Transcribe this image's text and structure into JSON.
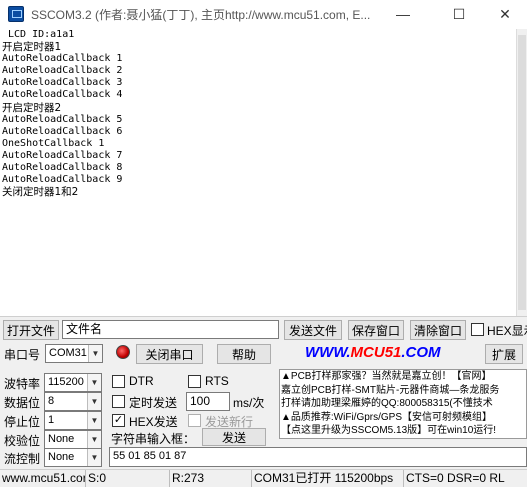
{
  "window": {
    "title": "SSCOM3.2 (作者:聂小猛(丁丁), 主页http://www.mcu51.com,  E...",
    "min_glyph": "—",
    "max_glyph": "☐",
    "close_glyph": "✕"
  },
  "receive_lines": [
    " LCD ID:a1a1",
    "开启定时器1",
    "AutoReloadCallback 1",
    "AutoReloadCallback 2",
    "AutoReloadCallback 3",
    "AutoReloadCallback 4",
    "开启定时器2",
    "AutoReloadCallback 5",
    "AutoReloadCallback 6",
    "OneShotCallback 1",
    "AutoReloadCallback 7",
    "AutoReloadCallback 8",
    "AutoReloadCallback 9",
    "关闭定时器1和2"
  ],
  "file_row": {
    "open_file_label": "打开文件",
    "filename_value": "文件名",
    "send_file_label": "发送文件",
    "save_window_label": "保存窗口",
    "clear_window_label": "清除窗口",
    "hex_display_label": "HEX显示"
  },
  "port_row": {
    "port_label": "串口号",
    "port_value": "COM31",
    "close_port_label": "关闭串口",
    "help_label": "帮助",
    "logo_blue_1": "WWW.",
    "logo_red": "MCU51",
    "logo_blue_2": ".COM",
    "expand_label": "扩展"
  },
  "settings": {
    "baud_label": "波特率",
    "baud_value": "115200",
    "databits_label": "数据位",
    "databits_value": "8",
    "stopbits_label": "停止位",
    "stopbits_value": "1",
    "parity_label": "校验位",
    "parity_value": "None",
    "flow_label": "流控制",
    "flow_value": "None"
  },
  "options": {
    "dtr_label": "DTR",
    "rts_label": "RTS",
    "timed_send_label": "定时发送",
    "interval_value": "100",
    "interval_unit": "ms/次",
    "hex_send_label": "HEX发送",
    "hex_send_checked": "✓",
    "send_newline_label": "发送新行",
    "input_label": "字符串输入框：",
    "send_label": "发送",
    "send_input_value": "55 01 85 01 87"
  },
  "ad_lines": [
    "▲PCB打样那家强？当然就是嘉立创！【官网】",
    "嘉立创PCB打样-SMT贴片-元器件商城—条龙服务",
    "打样请加助理梁雁婷的QQ:800058315(不懂技术",
    "▲品质推荐:WiFi/Gprs/GPS【安信可射频模组】",
    "【点这里升级为SSCOM5.13版】可在win10运行!"
  ],
  "status_bar": {
    "site": "www.mcu51.cor",
    "sent": "S:0",
    "received": "R:273",
    "port_status": "COM31已打开  115200bps",
    "signals": "CTS=0 DSR=0 RL"
  }
}
